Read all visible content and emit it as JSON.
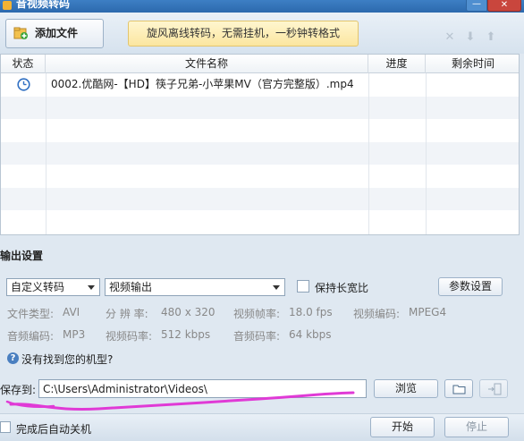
{
  "window": {
    "title": "音视频转码",
    "close_glyph": "✕",
    "minimize_glyph": "—"
  },
  "toolbar": {
    "add_file_label": "添加文件",
    "ad_text": "旋风离线转码，无需挂机，一秒钟转格式",
    "icons": [
      "remove-icon",
      "move-down-icon",
      "move-up-icon"
    ]
  },
  "table": {
    "headers": [
      "状态",
      "文件名称",
      "进度",
      "剩余时间"
    ],
    "rows": [
      {
        "status_icon": "clock-icon",
        "filename": "0002.优酷网-【HD】筷子兄弟-小苹果MV（官方完整版）.mp4",
        "progress": "",
        "remaining": ""
      }
    ]
  },
  "output": {
    "title": "输出设置",
    "preset_select": "自定义转码",
    "mode_select": "视频输出",
    "keep_aspect_label": "保持长宽比",
    "params_button": "参数设置",
    "info": {
      "file_type_label": "文件类型:",
      "file_type": "AVI",
      "resolution_label": "分 辨 率:",
      "resolution": "480 x 320",
      "frame_rate_label": "视频帧率:",
      "frame_rate": "18.0 fps",
      "video_codec_label": "视频编码:",
      "video_codec": "MPEG4",
      "audio_codec_label": "音频编码:",
      "audio_codec": "MP3",
      "video_bitrate_label": "视频码率:",
      "video_bitrate": "512 kbps",
      "audio_bitrate_label": "音频码率:",
      "audio_bitrate": "64 kbps"
    },
    "help_text": "没有找到您的机型?"
  },
  "save": {
    "label": "保存到:",
    "path": "C:\\Users\\Administrator\\Videos\\",
    "browse_button": "浏览"
  },
  "bottom": {
    "auto_shutdown_label": "完成后自动关机",
    "start_button": "开始",
    "stop_button": "停止"
  },
  "colors": {
    "title_bar": "#2c69ad",
    "ad_bg": "#fbe6a0",
    "annotation": "#e03ad6"
  }
}
